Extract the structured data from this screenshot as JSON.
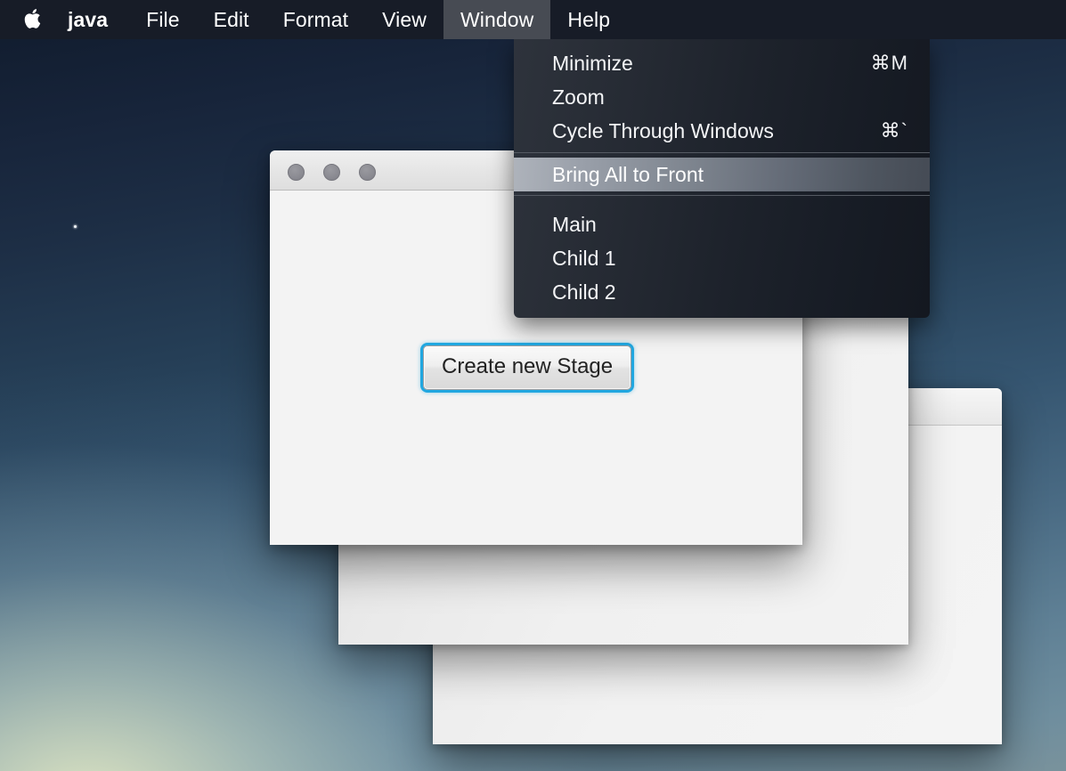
{
  "menubar": {
    "apple_icon": "apple-logo-icon",
    "items": [
      {
        "label": "java",
        "active": false,
        "bold": true
      },
      {
        "label": "File",
        "active": false
      },
      {
        "label": "Edit",
        "active": false
      },
      {
        "label": "Format",
        "active": false
      },
      {
        "label": "View",
        "active": false
      },
      {
        "label": "Window",
        "active": true
      },
      {
        "label": "Help",
        "active": false
      }
    ]
  },
  "window_menu": {
    "open_for": "Window",
    "items": [
      {
        "label": "Minimize",
        "shortcut": "⌘M",
        "highlighted": false
      },
      {
        "label": "Zoom",
        "shortcut": "",
        "highlighted": false
      },
      {
        "label": "Cycle Through Windows",
        "shortcut": "⌘`",
        "highlighted": false
      },
      {
        "label": "Bring All to Front",
        "shortcut": "",
        "highlighted": true
      },
      {
        "label": "Main",
        "shortcut": "",
        "highlighted": false
      },
      {
        "label": "Child 1",
        "shortcut": "",
        "highlighted": false
      },
      {
        "label": "Child 2",
        "shortcut": "",
        "highlighted": false
      }
    ]
  },
  "windows": [
    {
      "name": "Main",
      "title": "",
      "button_label": "Create new Stage",
      "traffic_lights": [
        "close-button",
        "minimize-button",
        "zoom-button"
      ]
    },
    {
      "name": "Child 1",
      "title": "",
      "button_label": ""
    },
    {
      "name": "Child 2",
      "title": "",
      "button_label": ""
    }
  ],
  "colors": {
    "menubar_bg": "#171c27",
    "menubar_active": "#474b53",
    "menu_panel_bg": "#232831",
    "menu_highlight": "#8d939d",
    "focus_ring": "#21a7e0",
    "window_bg": "#f3f3f3",
    "traffic_light": "#8b8b92",
    "desktop_top": "#101b2c",
    "desktop_bottom": "#79929c"
  }
}
